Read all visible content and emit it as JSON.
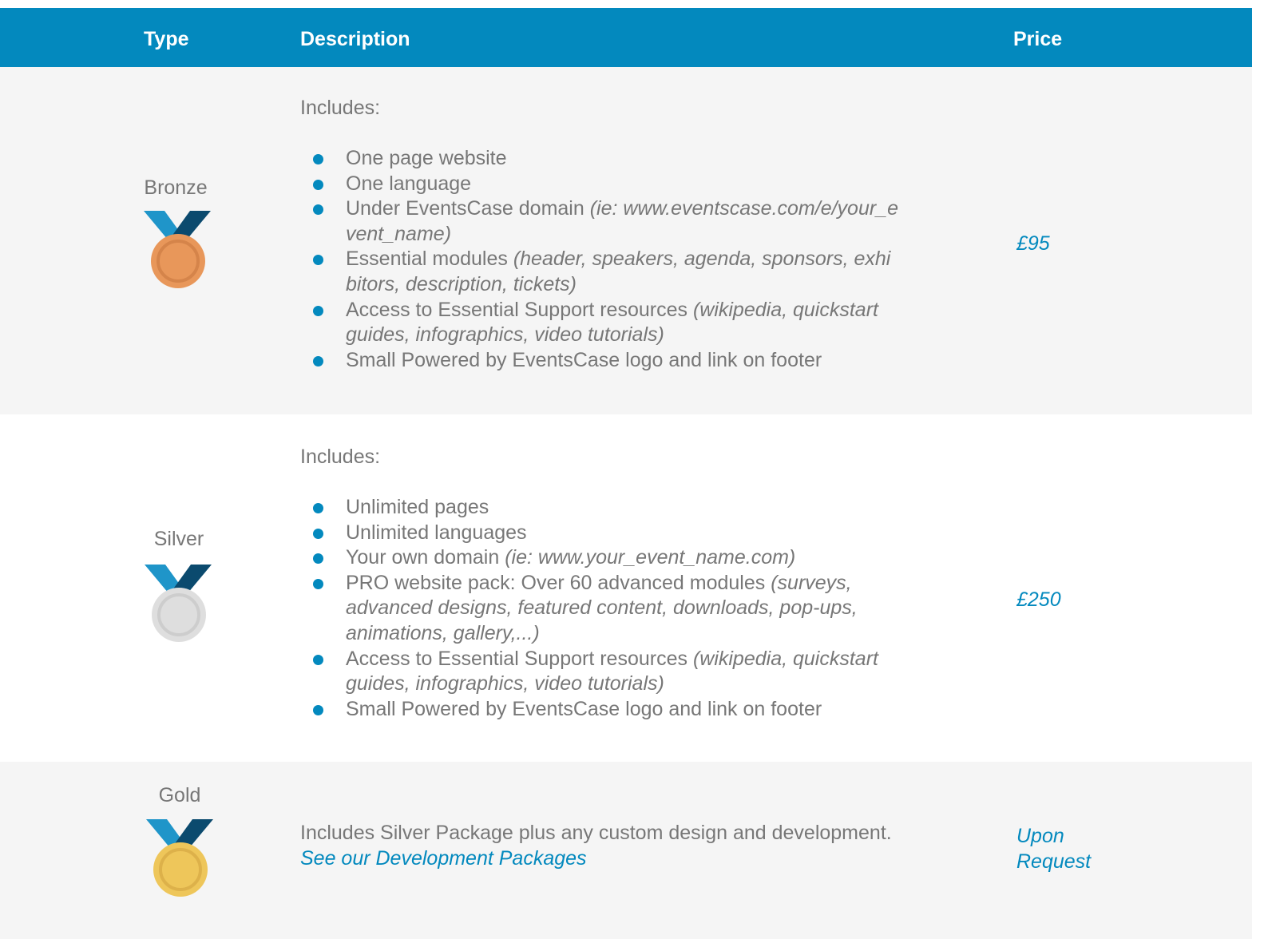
{
  "colors": {
    "header_bg": "#0389be",
    "accent": "#0389be",
    "row_shade": "#f5f5f5",
    "text": "#777777",
    "ribbon_light": "#1f95c9",
    "ribbon_dark": "#0b4a6e",
    "bronze": "#e8975a",
    "silver": "#dedede",
    "gold": "#eec65a"
  },
  "header": {
    "type": "Type",
    "description": "Description",
    "price": "Price"
  },
  "rows": [
    {
      "type": "Bronze",
      "medal_icon": "bronze-medal-icon",
      "intro": "Includes:",
      "features": [
        {
          "text": "One page website",
          "note": ""
        },
        {
          "text": "One language",
          "note": ""
        },
        {
          "text": "Under EventsCase domain ",
          "note": "(ie: www.eventscase.com/e/your_e vent_name)"
        },
        {
          "text": "Essential modules ",
          "note": "(header, speakers, agenda, sponsors, exhi bitors, description, tickets)"
        },
        {
          "text": "Access to Essential Support resources ",
          "note": "(wikipedia, quickstart guides, infographics, video tutorials)"
        },
        {
          "text": "Small Powered by EventsCase logo and link on footer",
          "note": ""
        }
      ],
      "price": "£95"
    },
    {
      "type": "Silver",
      "medal_icon": "silver-medal-icon",
      "intro": "Includes:",
      "features": [
        {
          "text": "Unlimited pages",
          "note": ""
        },
        {
          "text": "Unlimited languages",
          "note": ""
        },
        {
          "text": "Your own domain ",
          "note": "(ie: www.your_event_name.com)"
        },
        {
          "text": "PRO website pack: Over 60 advanced modules ",
          "note": "(surveys, advanced designs, featured content, downloads, pop-ups, animations, gallery,...)"
        },
        {
          "text": "Access to Essential Support resources ",
          "note": "(wikipedia, quickstart guides, infographics, video tutorials)"
        },
        {
          "text": "Small Powered by EventsCase logo and link on footer",
          "note": ""
        }
      ],
      "price": "£250"
    },
    {
      "type": "Gold",
      "medal_icon": "gold-medal-icon",
      "description": "Includes Silver Package plus any custom design and development.",
      "link": "See our Development Packages",
      "price": "Upon Request"
    }
  ]
}
